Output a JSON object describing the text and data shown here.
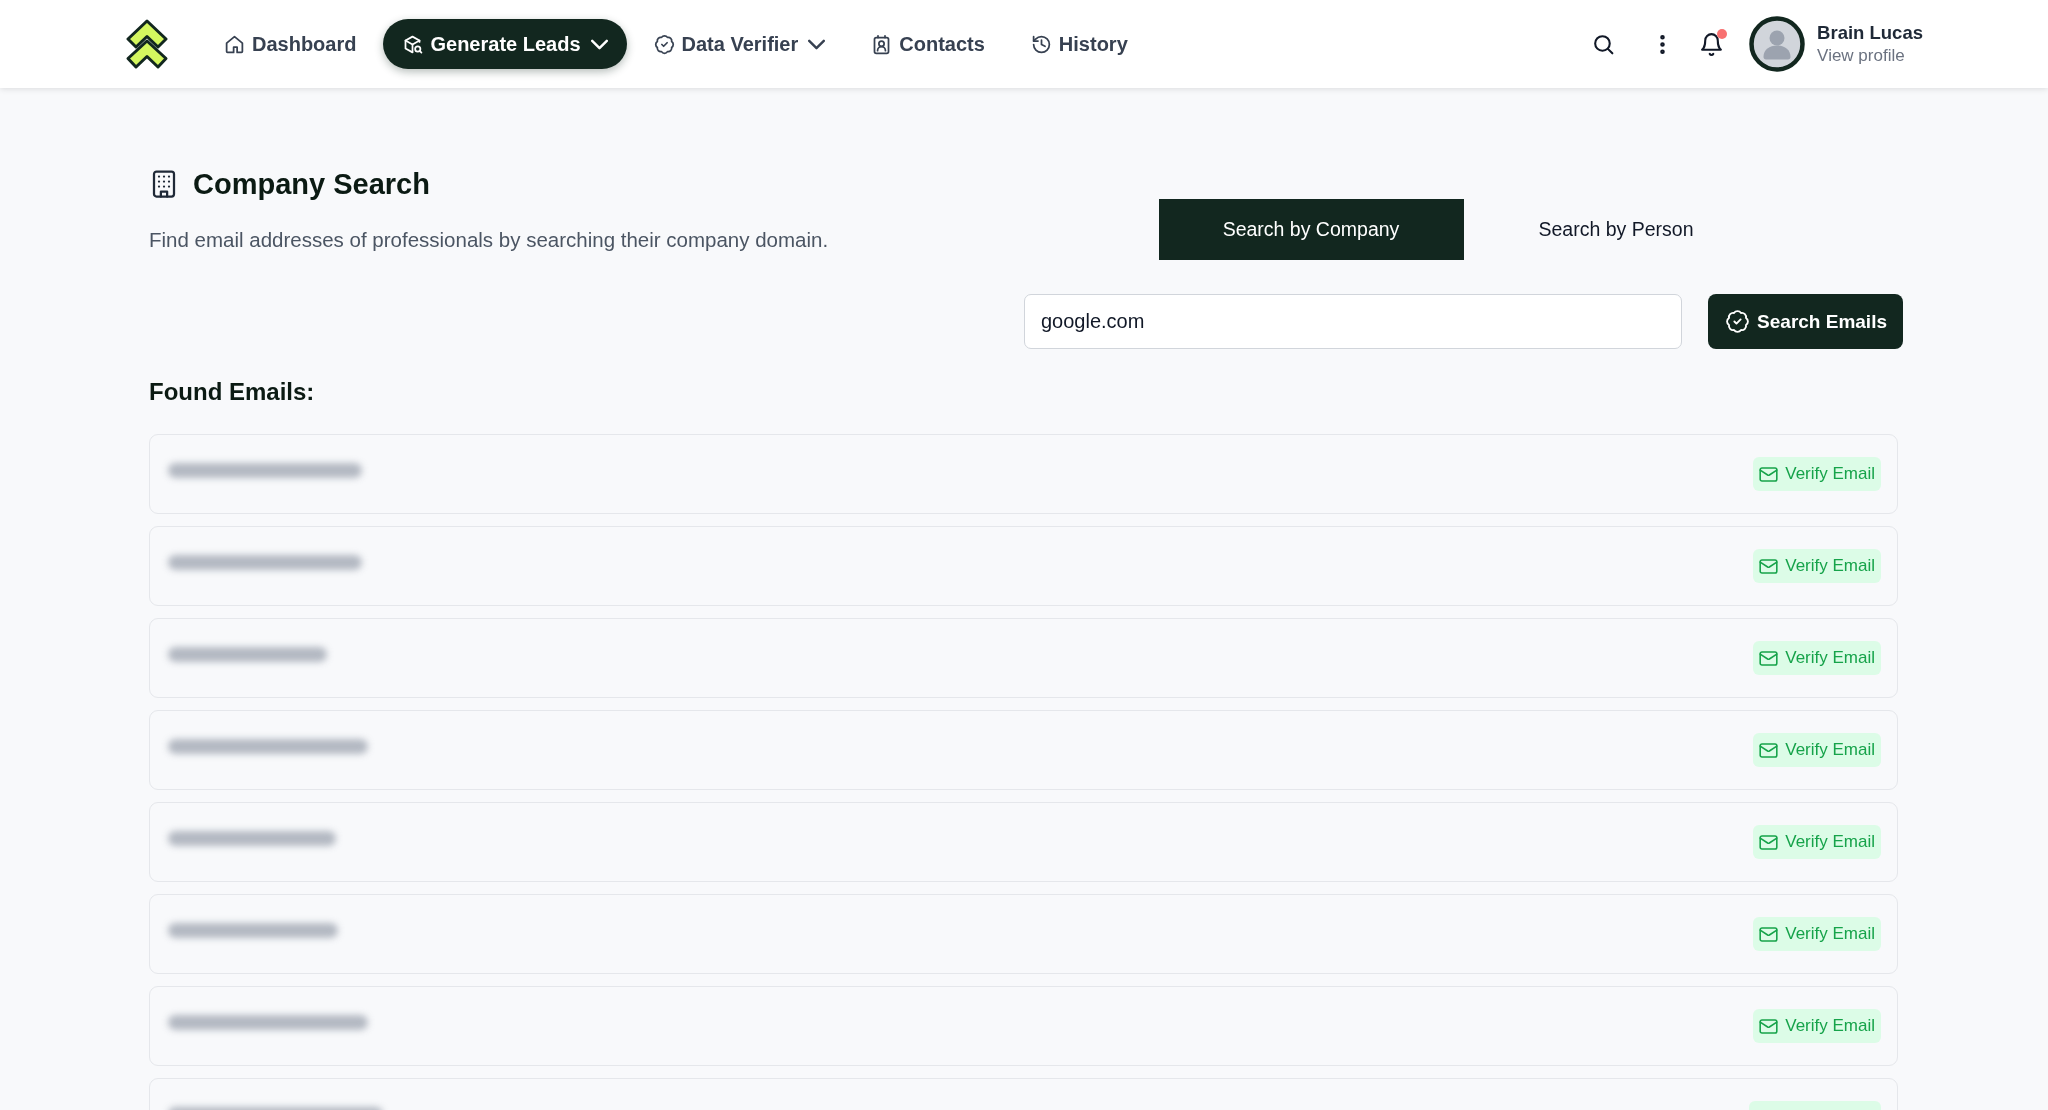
{
  "nav": {
    "items": [
      {
        "label": "Dashboard",
        "selected": false,
        "dropdown": false
      },
      {
        "label": "Generate Leads",
        "selected": true,
        "dropdown": true
      },
      {
        "label": "Data Verifier",
        "selected": false,
        "dropdown": true
      },
      {
        "label": "Contacts",
        "selected": false,
        "dropdown": false
      },
      {
        "label": "History",
        "selected": false,
        "dropdown": false
      }
    ]
  },
  "user": {
    "name": "Brain Lucas",
    "link": "View profile",
    "unread": true
  },
  "company_search": {
    "title": "Company Search",
    "description": "Find email addresses of professionals by searching their company domain.",
    "tabs": [
      {
        "label": "Search by Company",
        "selected": true
      },
      {
        "label": "Search by Person",
        "selected": false
      }
    ],
    "domain_field": {
      "value": "google.com"
    },
    "search_button": "Search Emails"
  },
  "found_emails": {
    "heading": "Found Emails:",
    "rows": [
      {
        "kind": "redacted",
        "action": "Verify Email"
      },
      {
        "kind": "redacted",
        "action": "Verify Email"
      },
      {
        "kind": "redacted",
        "action": "Verify Email"
      },
      {
        "kind": "redacted",
        "action": "Verify Email"
      },
      {
        "kind": "redacted",
        "action": "Verify Email"
      },
      {
        "kind": "redacted",
        "action": "Verify Email"
      },
      {
        "kind": "redacted",
        "action": "Verify Email"
      },
      {
        "kind": "redacted"
      }
    ]
  }
}
